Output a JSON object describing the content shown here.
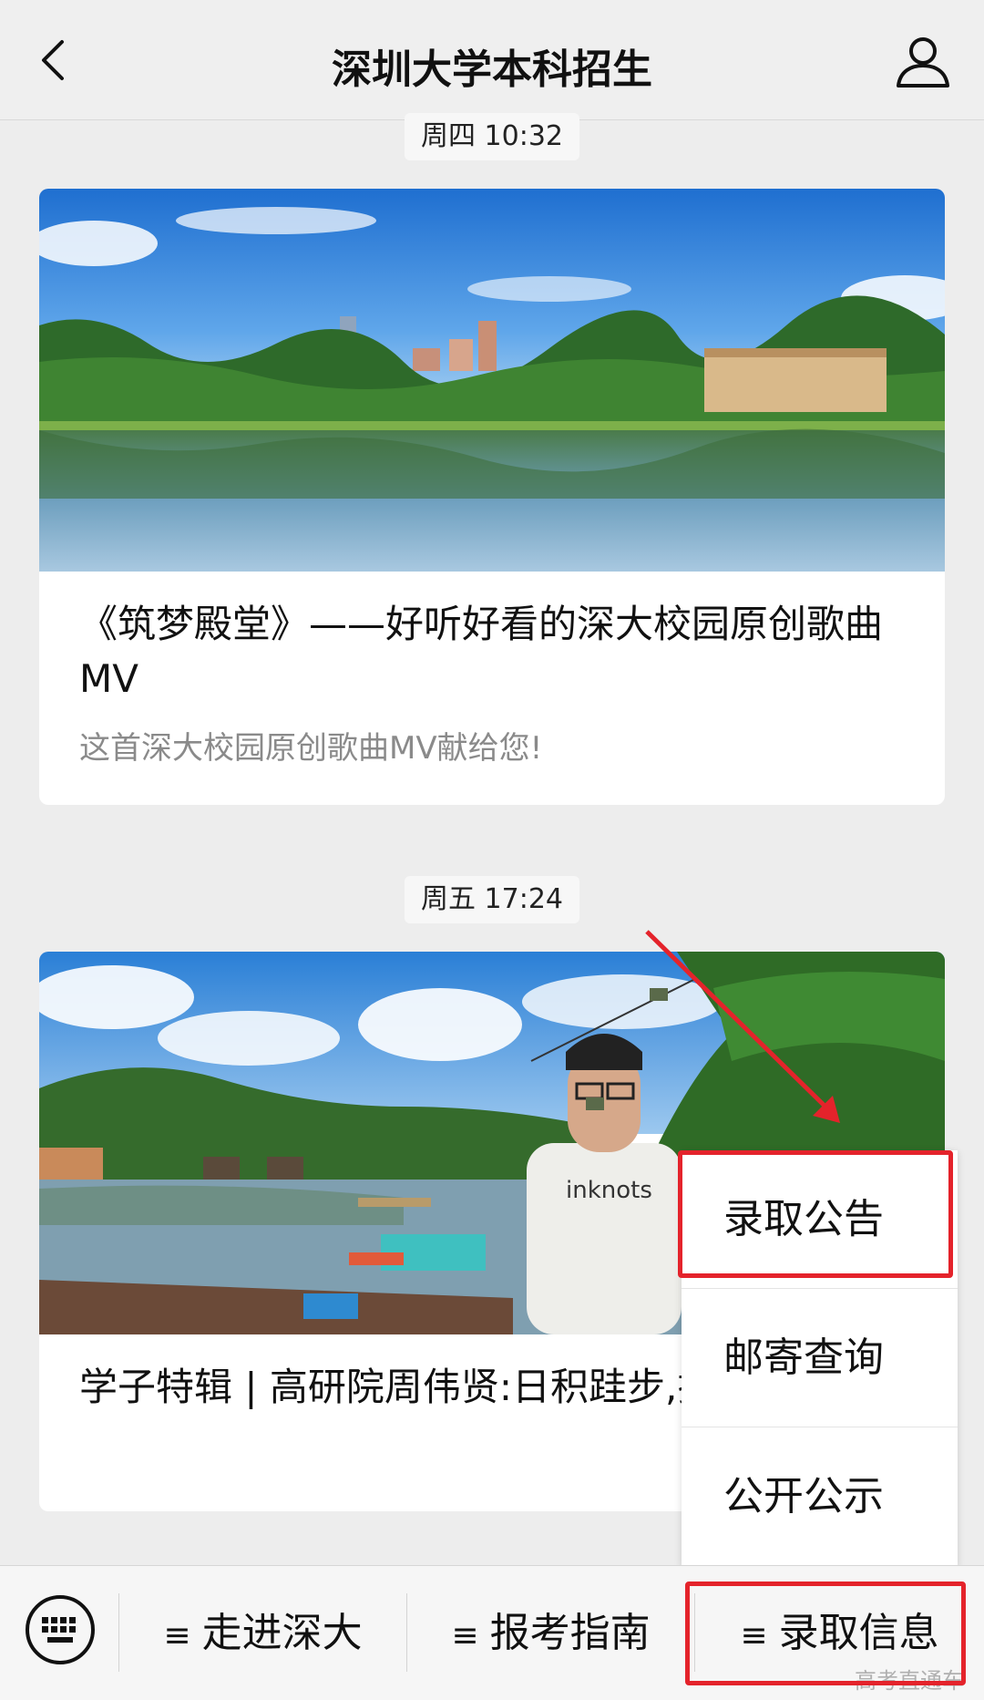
{
  "header": {
    "title": "深圳大学本科招生"
  },
  "messages": [
    {
      "time": "周四 10:32",
      "title": "《筑梦殿堂》——好听好看的深大校园原创歌曲MV",
      "desc": "这首深大校园原创歌曲MV献给您!"
    },
    {
      "time": "周五 17:24",
      "title": "学子特辑 | 高研院周伟贤:日积跬步,探索",
      "shirt_text": "inknots"
    }
  ],
  "popup_menu": {
    "items": [
      "录取公告",
      "邮寄查询",
      "公开公示"
    ]
  },
  "bottom_menu": {
    "items": [
      "走进深大",
      "报考指南",
      "录取信息"
    ],
    "bars_glyph": "≡"
  },
  "watermark": "高考直通车",
  "colors": {
    "highlight": "#e4232b",
    "background": "#ededed"
  }
}
